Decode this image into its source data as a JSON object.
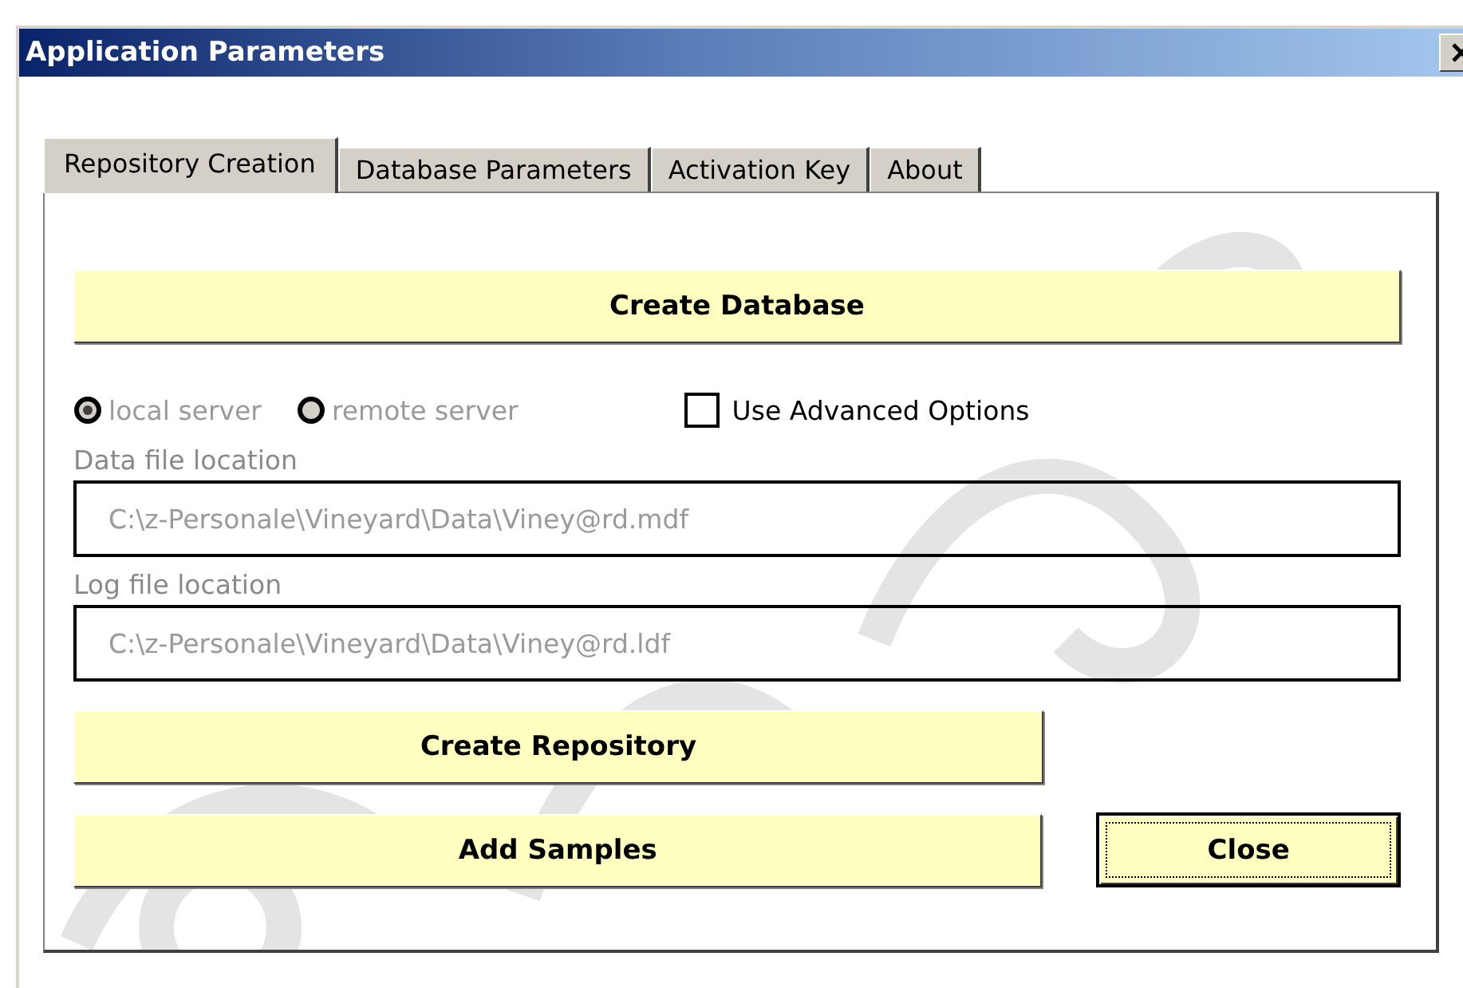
{
  "window": {
    "title": "Application Parameters"
  },
  "tabs": [
    {
      "label": "Repository Creation",
      "selected": true
    },
    {
      "label": "Database Parameters",
      "selected": false
    },
    {
      "label": "Activation Key",
      "selected": false
    },
    {
      "label": "About",
      "selected": false
    }
  ],
  "create_database_button": "Create Database",
  "server_options": [
    {
      "label": "local server",
      "selected": true,
      "disabled": true
    },
    {
      "label": "remote server",
      "selected": false,
      "disabled": true
    }
  ],
  "advanced_options": {
    "label": "Use Advanced Options",
    "checked": false
  },
  "fields": [
    {
      "label": "Data file location",
      "value": "C:\\z-Personale\\Vineyard\\Data\\Viney@rd.mdf",
      "disabled": true
    },
    {
      "label": "Log file location",
      "value": "C:\\z-Personale\\Vineyard\\Data\\Viney@rd.ldf",
      "disabled": true
    }
  ],
  "create_repository_button": "Create Repository",
  "add_samples_button": "Add Samples",
  "close_button": {
    "label": "Close",
    "focused": true
  }
}
